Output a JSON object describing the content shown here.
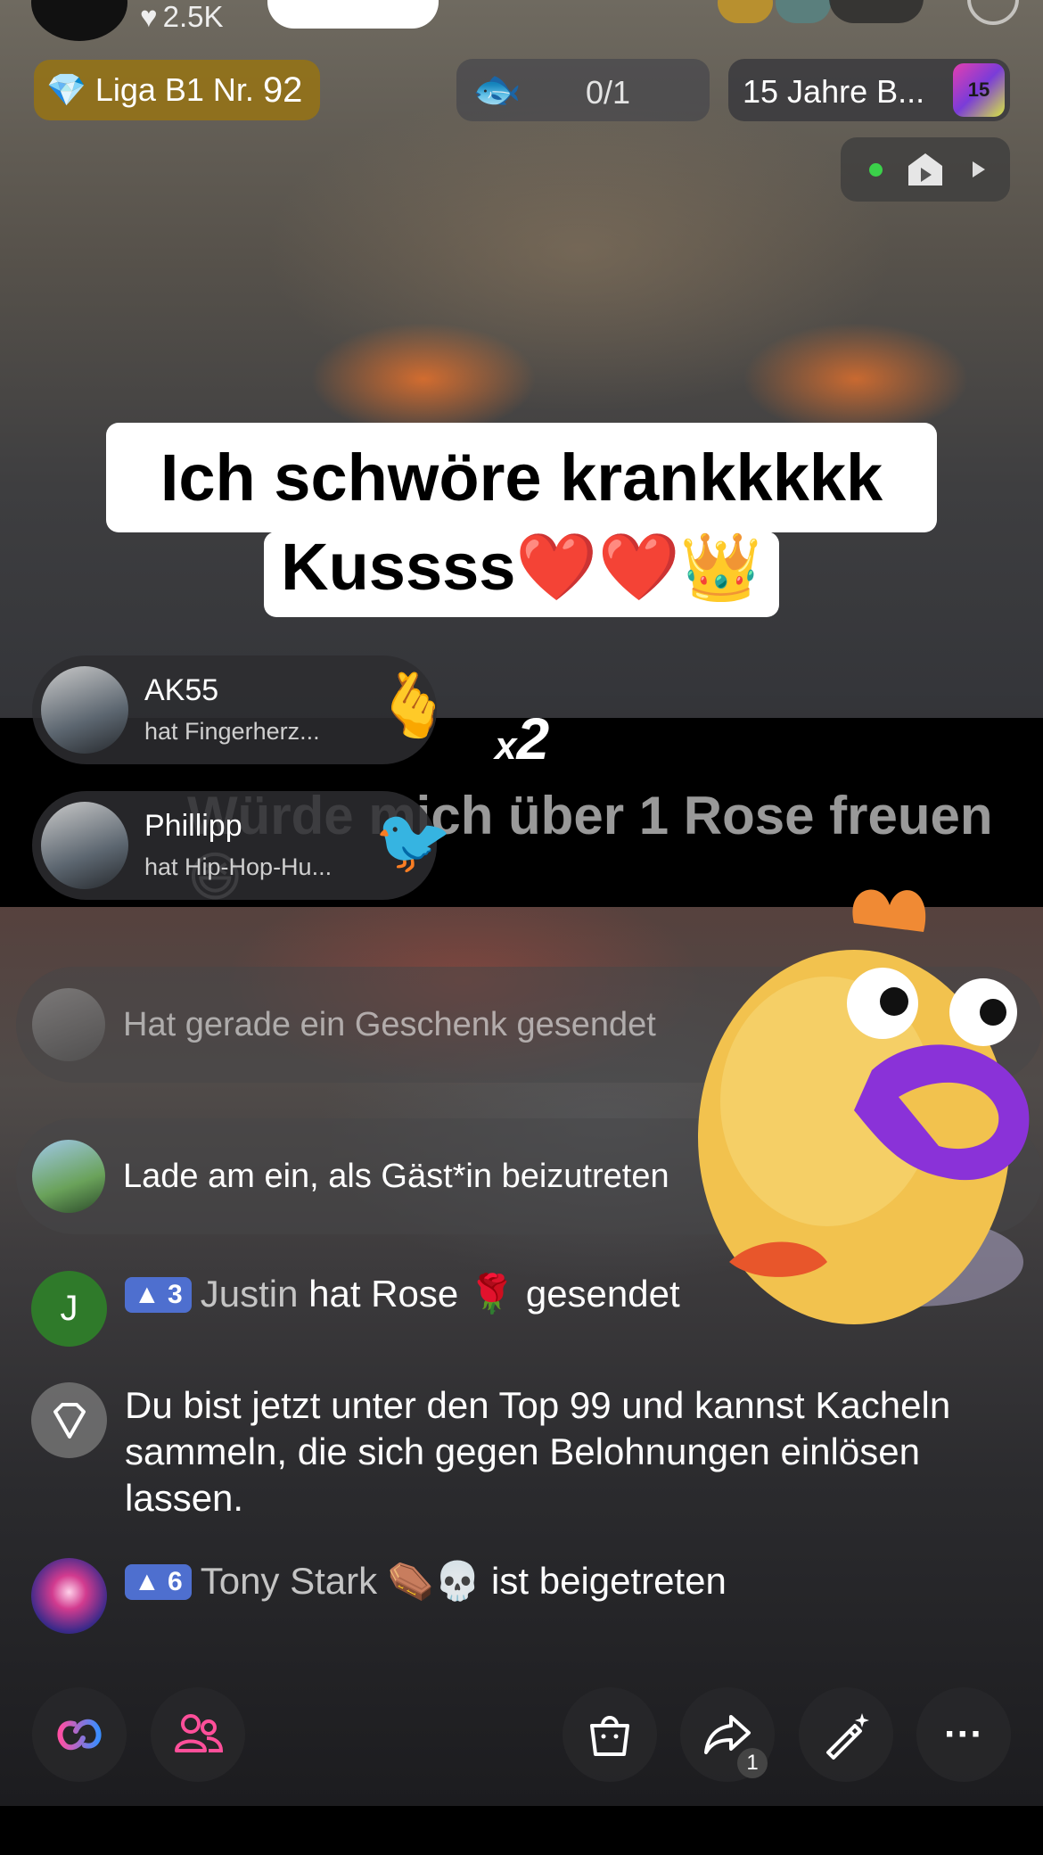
{
  "header": {
    "likes": "2.5K",
    "league_label": "Liga B1 Nr.",
    "league_number": "92",
    "progress": "0/1",
    "event_title": "15 Jahre B...",
    "event_badge": "15"
  },
  "captions": {
    "line1": "Ich schwöre krankkkkk",
    "line2": "Kussss❤️❤️👑"
  },
  "gifts": [
    {
      "name": "AK55",
      "action": "hat Fingerherz...",
      "emoji": "🫰"
    },
    {
      "name": "Phillipp",
      "action": "hat Hip-Hop-Hu...",
      "emoji": "🐦"
    }
  ],
  "combo": {
    "x": "x",
    "count": "2"
  },
  "background_message": "Würde mich über 1 Rose freuen😆",
  "system_messages": [
    {
      "text": "Hat gerade ein Geschenk gesendet"
    },
    {
      "text": "Lade am ein, als Gäst*in beizutreten"
    }
  ],
  "chat": [
    {
      "avatar_letter": "J",
      "level": "3",
      "user": "Justin",
      "message": " hat Rose 🌹 gesendet"
    },
    {
      "message": "Du bist jetzt unter den Top 99 und kannst Kacheln sammeln, die sich gegen Belohnungen einlösen lassen."
    },
    {
      "level": "6",
      "user": "Tony Stark ⚰️💀",
      "message": " ist beigetreten"
    }
  ],
  "toolbar": {
    "share_count": "1",
    "more_label": "···"
  },
  "colors": {
    "league_gold": "#967314",
    "level_badge": "#4e6fcf",
    "live_green": "#3bd14a",
    "caption_bg": "#ffffff"
  }
}
